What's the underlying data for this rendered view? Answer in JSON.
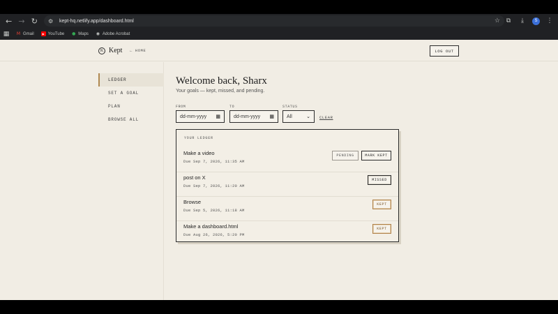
{
  "browser": {
    "url": "kept-hq.netlify.app/dashboard.html",
    "profile_initial": "S",
    "bookmarks": [
      {
        "label": "Gmail",
        "icon": "gmail-icon"
      },
      {
        "label": "YouTube",
        "icon": "youtube-icon"
      },
      {
        "label": "Maps",
        "icon": "maps-icon"
      },
      {
        "label": "Adobe Acrobat",
        "icon": "acrobat-icon"
      }
    ]
  },
  "header": {
    "brand_initial": "K",
    "brand_name": "Kept",
    "home_link": "← HOME",
    "logout_label": "LOG OUT"
  },
  "sidebar": {
    "items": [
      {
        "label": "LEDGER",
        "active": true
      },
      {
        "label": "SET A GOAL",
        "active": false
      },
      {
        "label": "PLAN",
        "active": false
      },
      {
        "label": "BROWSE ALL",
        "active": false
      }
    ]
  },
  "main": {
    "welcome": "Welcome back, Sharx",
    "subtitle": "Your goals — kept, missed, and pending.",
    "filters": {
      "from_label": "FROM",
      "from_placeholder": "dd-mm-yyyy",
      "to_label": "TO",
      "to_placeholder": "dd-mm-yyyy",
      "status_label": "STATUS",
      "status_value": "All",
      "clear_label": "CLEAR"
    },
    "ledger": {
      "title": "YOUR LEDGER",
      "rows": [
        {
          "title": "Make a video",
          "due": "Due Sep 7, 2026, 11:35 AM",
          "buttons": [
            "PENDING",
            "MARK KEPT"
          ]
        },
        {
          "title": "post on X",
          "due": "Due Sep 7, 2026, 11:20 AM",
          "buttons": [
            "MISSED"
          ]
        },
        {
          "title": "Browse",
          "due": "Due Sep 5, 2026, 11:18 AM",
          "buttons": [
            "KEPT"
          ]
        },
        {
          "title": "Make a dashboard.html",
          "due": "Due Aug 26, 2026, 5:20 PM",
          "buttons": [
            "KEPT"
          ]
        }
      ]
    }
  }
}
